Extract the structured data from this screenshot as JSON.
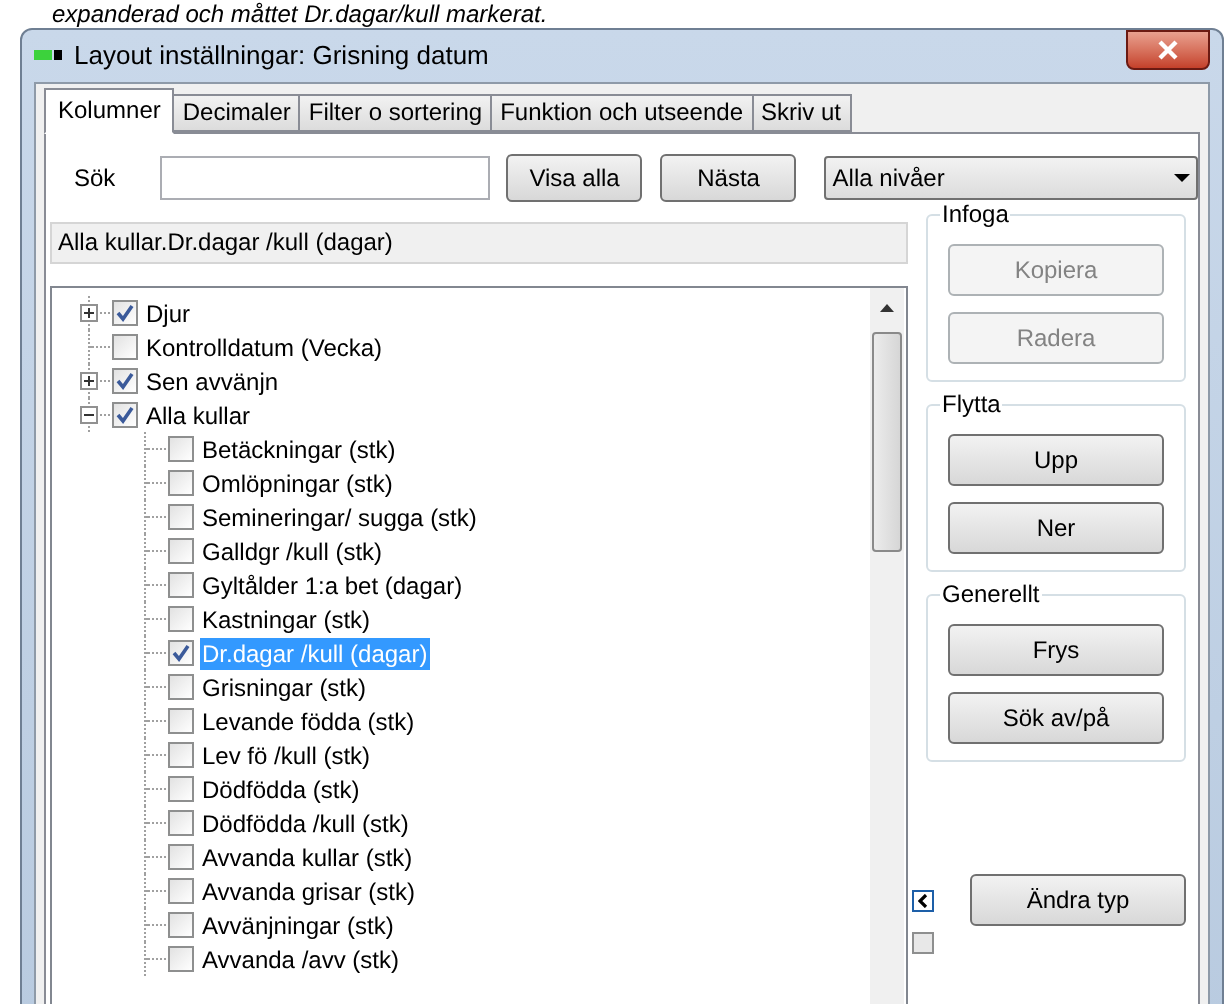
{
  "caption": "expanderad och måttet Dr.dagar/kull markerat.",
  "window": {
    "title": "Layout inställningar: Grisning datum"
  },
  "tabs": [
    {
      "label": "Kolumner",
      "selected": true
    },
    {
      "label": "Decimaler",
      "selected": false
    },
    {
      "label": "Filter o sortering",
      "selected": false
    },
    {
      "label": "Funktion och utseende",
      "selected": false
    },
    {
      "label": "Skriv ut",
      "selected": false
    }
  ],
  "search": {
    "label": "Sök",
    "buttons": [
      "Visa alla",
      "Nästa"
    ],
    "level_dropdown": "Alla nivåer"
  },
  "path_field": "Alla kullar.Dr.dagar /kull (dagar)",
  "tree": [
    {
      "label": "Djur",
      "checked": true,
      "selected": false,
      "expanded": false
    },
    {
      "label": "Kontrolldatum (Vecka)",
      "checked": false,
      "selected": false
    },
    {
      "label": "Sen avvänjn",
      "checked": true,
      "selected": false,
      "expanded": false
    },
    {
      "label": "Alla kullar",
      "checked": true,
      "selected": false,
      "expanded": true,
      "children": [
        {
          "label": "Betäckningar (stk)",
          "checked": false,
          "selected": false
        },
        {
          "label": "Omlöpningar (stk)",
          "checked": false,
          "selected": false
        },
        {
          "label": "Semineringar/ sugga (stk)",
          "checked": false,
          "selected": false
        },
        {
          "label": "Galldgr /kull (stk)",
          "checked": false,
          "selected": false
        },
        {
          "label": "Gyltålder 1:a bet (dagar)",
          "checked": false,
          "selected": false
        },
        {
          "label": "Kastningar (stk)",
          "checked": false,
          "selected": false
        },
        {
          "label": "Dr.dagar /kull (dagar)",
          "checked": true,
          "selected": true
        },
        {
          "label": "Grisningar (stk)",
          "checked": false,
          "selected": false
        },
        {
          "label": "Levande födda (stk)",
          "checked": false,
          "selected": false
        },
        {
          "label": "Lev fö /kull (stk)",
          "checked": false,
          "selected": false
        },
        {
          "label": "Dödfödda (stk)",
          "checked": false,
          "selected": false
        },
        {
          "label": "Dödfödda /kull (stk)",
          "checked": false,
          "selected": false
        },
        {
          "label": "Avvanda kullar (stk)",
          "checked": false,
          "selected": false
        },
        {
          "label": "Avvanda grisar (stk)",
          "checked": false,
          "selected": false
        },
        {
          "label": "Avvänjningar (stk)",
          "checked": false,
          "selected": false
        },
        {
          "label": "Avvanda /avv (stk)",
          "checked": false,
          "selected": false
        }
      ]
    }
  ],
  "groups": [
    {
      "title": "Infoga",
      "buttons": [
        {
          "label": "Kopiera",
          "disabled": true
        },
        {
          "label": "Radera",
          "disabled": true
        }
      ]
    },
    {
      "title": "Flytta",
      "buttons": [
        {
          "label": "Upp",
          "disabled": false
        },
        {
          "label": "Ner",
          "disabled": false
        }
      ]
    },
    {
      "title": "Generellt",
      "buttons": [
        {
          "label": "Frys",
          "disabled": false
        },
        {
          "label": "Sök av/på",
          "disabled": false
        }
      ]
    }
  ],
  "change_type_button": "Ändra typ",
  "bottom_checkbox": {
    "checked": false
  }
}
